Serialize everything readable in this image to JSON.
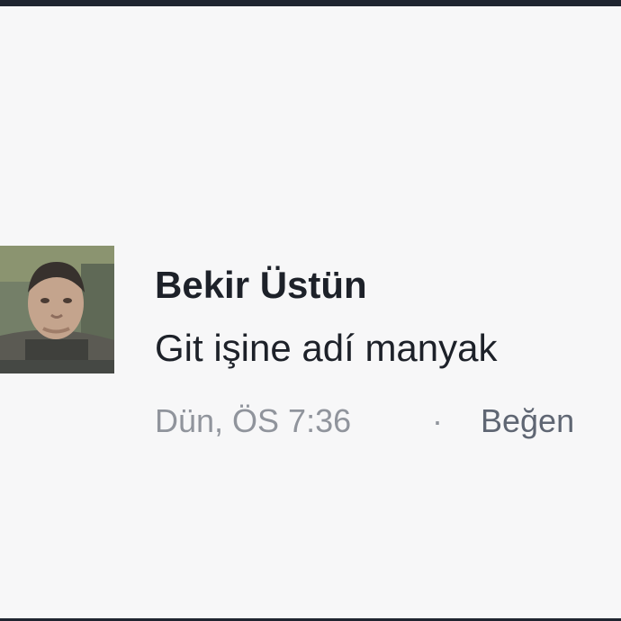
{
  "comment": {
    "author_name": "Bekir Üstün",
    "text": "Git işine adí manyak",
    "timestamp": "Dün, ÖS 7:36",
    "separator": "·",
    "like_label": "Beğen"
  }
}
